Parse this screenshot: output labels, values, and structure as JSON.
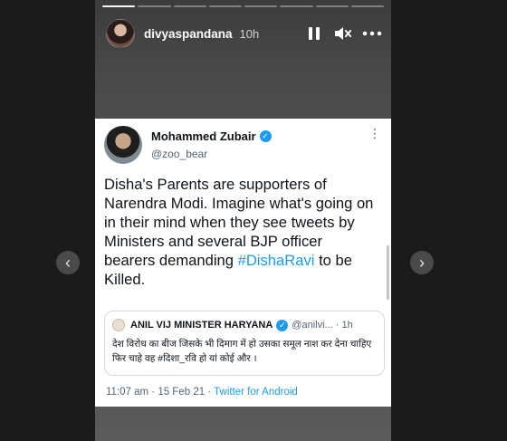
{
  "story": {
    "username": "divyaspandana",
    "time": "10h",
    "segments_total": 8,
    "segments_done": 1
  },
  "icons": {
    "pause": "pause-icon",
    "mute": "speaker-muted-icon",
    "more": "more-horizontal-icon",
    "prev": "chevron-left-icon",
    "next": "chevron-right-icon"
  },
  "tweet": {
    "name": "Mohammed Zubair",
    "handle": "@zoo_bear",
    "text_before": "Disha's Parents are supporters of Narendra Modi. Imagine what's going on in their mind when they see tweets by Ministers and several BJP officer bearers demanding ",
    "hashtag": "#DishaRavi",
    "text_after": " to be Killed.",
    "time": "11:07 am · 15 Feb 21 · ",
    "source": "Twitter for Android",
    "more": "⋮"
  },
  "quote": {
    "name": "ANIL VIJ MINISTER HARYANA",
    "handle": "@anilvi... · 1h",
    "text": "देश विरोध का बीज जिसके भी दिमाग में हो उसका समूल नाश कर देना चाहिए फिर चाहे वह #दिशा_रवि हो यां कोई और ।"
  },
  "colors": {
    "accent": "#1d9bf0",
    "background": "#1b1b1b"
  }
}
